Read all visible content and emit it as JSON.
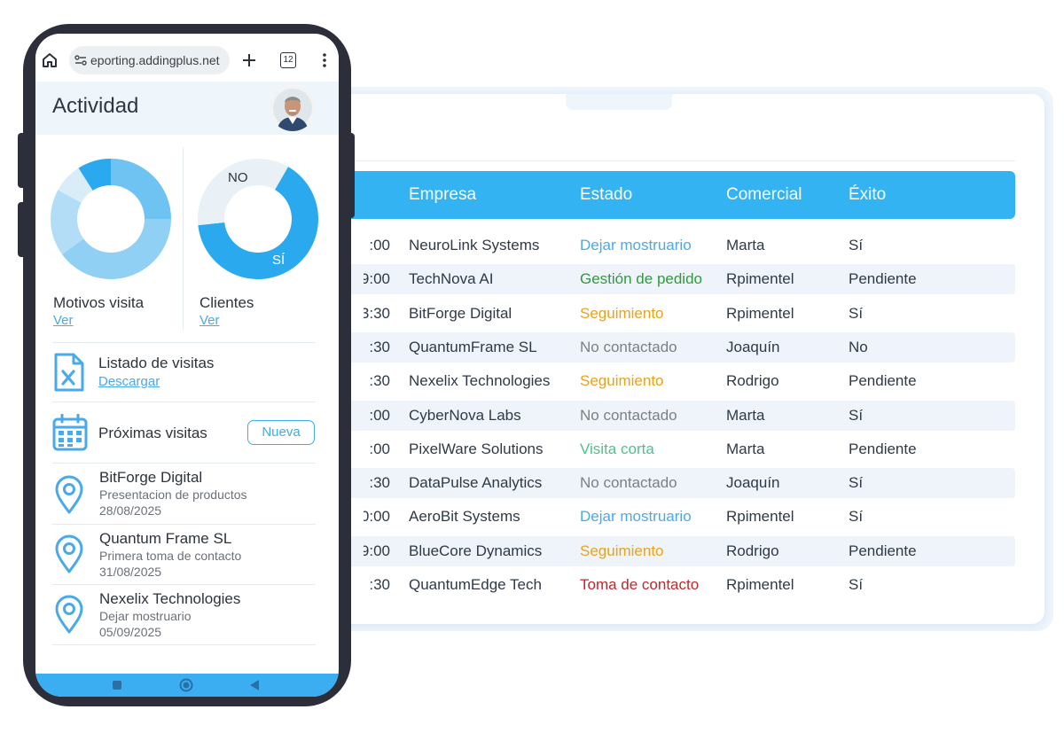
{
  "browser": {
    "url": "eporting.addingplus.net",
    "tab_count": "12"
  },
  "app": {
    "title": "Actividad"
  },
  "charts": [
    {
      "label": "Motivos visita",
      "link": "Ver"
    },
    {
      "label": "Clientes",
      "link": "Ver",
      "no_label": "NO",
      "si_label": "SÍ"
    }
  ],
  "chart_data": [
    {
      "type": "pie",
      "title": "Motivos visita",
      "values": [
        25,
        40,
        18,
        8,
        9
      ],
      "colors": [
        "#6ec3f2",
        "#91d0f5",
        "#b3ddf7",
        "#d9edf9",
        "#2aa9ee"
      ]
    },
    {
      "type": "pie",
      "title": "Clientes",
      "categories": [
        "SÍ",
        "NO"
      ],
      "values": [
        65,
        35
      ],
      "colors": [
        "#2aa9ee",
        "#e9f1f7"
      ]
    }
  ],
  "downloads": {
    "title": "Listado de visitas",
    "link": "Descargar"
  },
  "upcoming": {
    "title": "Próximas visitas",
    "new_button": "Nueva",
    "items": [
      {
        "company": "BitForge Digital",
        "reason": "Presentacion de productos",
        "date": "28/08/2025"
      },
      {
        "company": "Quantum Frame SL",
        "reason": "Primera toma de contacto",
        "date": "31/08/2025"
      },
      {
        "company": "Nexelix Technologies",
        "reason": "Dejar mostruario",
        "date": "05/09/2025"
      }
    ]
  },
  "table": {
    "headers": [
      "Empresa",
      "Estado",
      "Comercial",
      "Éxito"
    ],
    "rows": [
      {
        "time": ":00",
        "empresa": "NeuroLink Systems",
        "estado": "Dejar mostruario",
        "estado_color": "#4aa9e9",
        "comercial": "Marta",
        "exito": "Sí"
      },
      {
        "time": "9:00",
        "empresa": "TechNova AI",
        "estado": "Gestión de pedido",
        "estado_color": "#2e9b3c",
        "comercial": "Rpimentel",
        "exito": "Pendiente"
      },
      {
        "time": "3:30",
        "empresa": "BitForge Digital",
        "estado": "Seguimiento",
        "estado_color": "#e9a21c",
        "comercial": "Rpimentel",
        "exito": "Sí"
      },
      {
        "time": ":30",
        "empresa": "QuantumFrame SL",
        "estado": "No contactado",
        "estado_color": "#7b8086",
        "comercial": "Joaquín",
        "exito": "No"
      },
      {
        "time": ":30",
        "empresa": "Nexelix Technologies",
        "estado": "Seguimiento",
        "estado_color": "#e9a21c",
        "comercial": "Rodrigo",
        "exito": "Pendiente"
      },
      {
        "time": ":00",
        "empresa": "CyberNova Labs",
        "estado": "No contactado",
        "estado_color": "#7b8086",
        "comercial": "Marta",
        "exito": "Sí"
      },
      {
        "time": ":00",
        "empresa": "PixelWare Solutions",
        "estado": "Visita corta",
        "estado_color": "#4fc08d",
        "comercial": "Marta",
        "exito": "Pendiente"
      },
      {
        "time": ":30",
        "empresa": "DataPulse Analytics",
        "estado": "No contactado",
        "estado_color": "#7b8086",
        "comercial": "Joaquín",
        "exito": "Sí"
      },
      {
        "time": "0:00",
        "empresa": "AeroBit Systems",
        "estado": "Dejar mostruario",
        "estado_color": "#4aa9e9",
        "comercial": "Rpimentel",
        "exito": "Sí"
      },
      {
        "time": "9:00",
        "empresa": "BlueCore Dynamics",
        "estado": "Seguimiento",
        "estado_color": "#e9a21c",
        "comercial": "Rodrigo",
        "exito": "Pendiente"
      },
      {
        "time": ":30",
        "empresa": "QuantumEdge Tech",
        "estado": "Toma de contacto",
        "estado_color": "#c0282e",
        "comercial": "Rpimentel",
        "exito": "Sí"
      }
    ]
  },
  "colors": {
    "accent": "#33b3f1",
    "phone_frame": "#2c2e39",
    "row_alt": "#eef4f9"
  }
}
